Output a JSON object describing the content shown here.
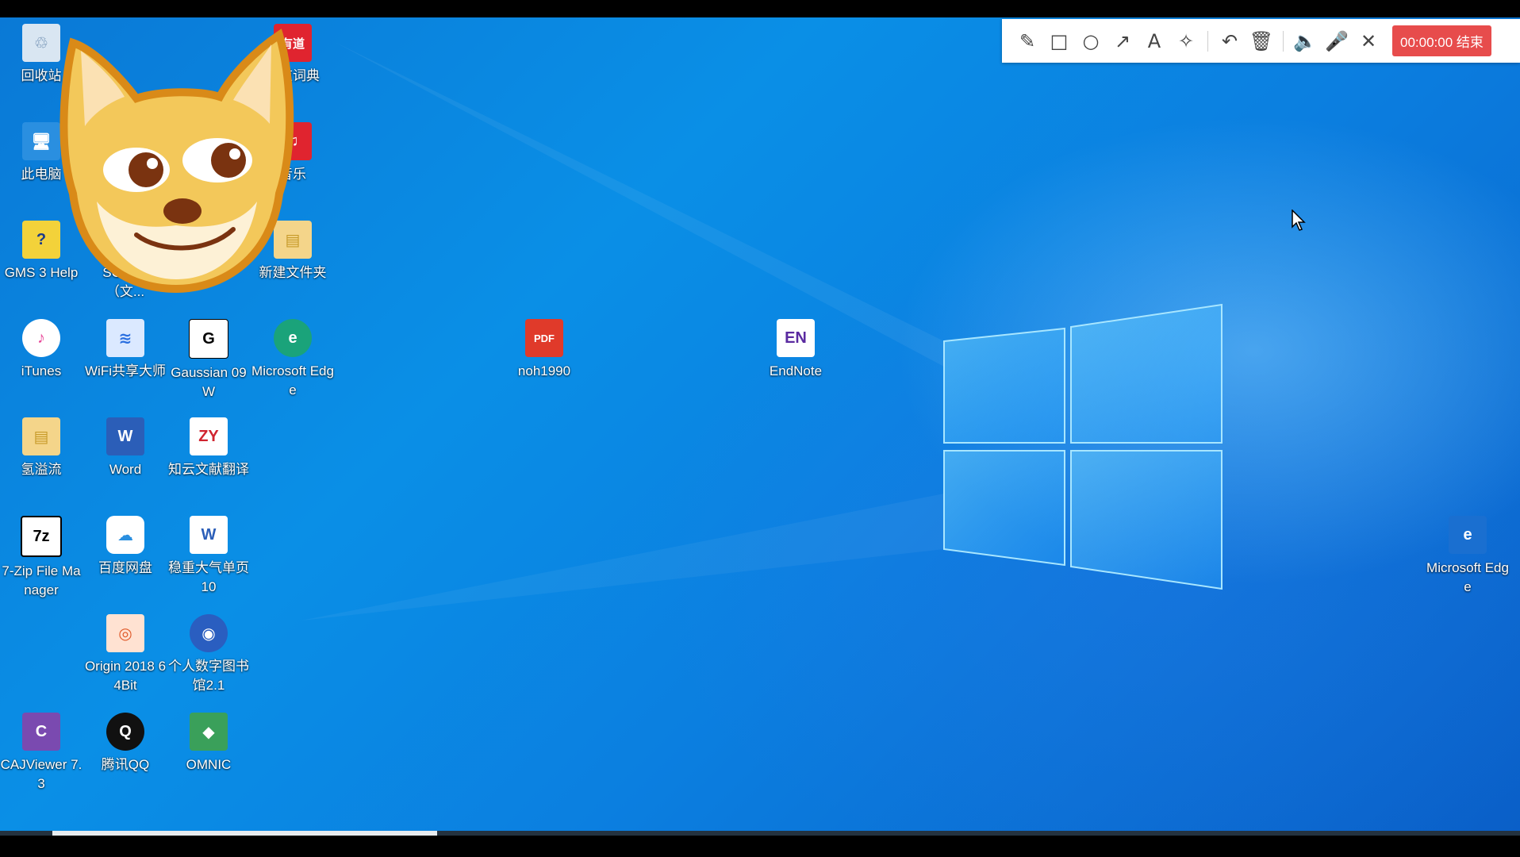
{
  "toolbar": {
    "tools": [
      {
        "icon": "pencil-icon",
        "glyph": "✎"
      },
      {
        "icon": "rectangle-icon",
        "glyph": "□"
      },
      {
        "icon": "circle-icon",
        "glyph": "○"
      },
      {
        "icon": "arrow-icon",
        "glyph": "↗"
      },
      {
        "icon": "text-icon",
        "glyph": "A"
      },
      {
        "icon": "magic-wand-icon",
        "glyph": "✧"
      }
    ],
    "undo_glyph": "↶",
    "delete_glyph": "🗑",
    "speaker_glyph": "🔈",
    "mic_glyph": "🎤",
    "close_glyph": "✕",
    "timer": "00:00:00 结束"
  },
  "desktop": {
    "icons": [
      {
        "label": "回收站",
        "icon": "recycle-bin-icon",
        "glyph": "♲",
        "color": "#d9e6f2",
        "fg": "#5a7ea6"
      },
      {
        "label": "有道词典",
        "icon": "youdao-dict-icon",
        "glyph": "有道",
        "color": "#e0242f",
        "fg": "#ffffff"
      },
      {
        "label": "此电脑",
        "icon": "this-pc-icon",
        "glyph": "🖥",
        "color": "#2a8fe0",
        "fg": "#ffffff"
      },
      {
        "label": "音乐",
        "icon": "netease-music-icon",
        "glyph": "♫",
        "color": "#e0242f",
        "fg": "#ffffff"
      },
      {
        "label": "GMS 3 Help",
        "icon": "help-file-icon",
        "glyph": "?",
        "color": "#f3d23a",
        "fg": "#1a3a8a"
      },
      {
        "label": "SC户端（文...",
        "icon": "app-shortcut-icon",
        "glyph": "S",
        "color": "#3a6fd0",
        "fg": "#ffffff"
      },
      {
        "label": "新建文件夹",
        "icon": "folder-icon",
        "glyph": "▤",
        "color": "#f4d58a",
        "fg": "#c79b2a"
      },
      {
        "label": "iTunes",
        "icon": "itunes-icon",
        "glyph": "♪",
        "color": "#ffffff",
        "fg": "#e84a9a"
      },
      {
        "label": "WiFi共享大师",
        "icon": "wifi-icon",
        "glyph": "≋",
        "color": "#dbe9ff",
        "fg": "#2a6fe0"
      },
      {
        "label": "Gaussian 09W",
        "icon": "gaussian-icon",
        "glyph": "G",
        "color": "#ffffff",
        "fg": "#000000"
      },
      {
        "label": "Microsoft Edge",
        "icon": "edge-icon",
        "glyph": "e",
        "color": "#1aa37a",
        "fg": "#ffffff"
      },
      {
        "label": "noh1990",
        "icon": "pdf-file-icon",
        "glyph": "PDF",
        "color": "#e03a2a",
        "fg": "#ffffff"
      },
      {
        "label": "EndNote",
        "icon": "endnote-icon",
        "glyph": "EN",
        "color": "#ffffff",
        "fg": "#5a2aa0"
      },
      {
        "label": "氢溢流",
        "icon": "folder-icon",
        "glyph": "▤",
        "color": "#f4d58a",
        "fg": "#c79b2a"
      },
      {
        "label": "Word",
        "icon": "word-icon",
        "glyph": "W",
        "color": "#2b5eb8",
        "fg": "#ffffff"
      },
      {
        "label": "知云文献翻译",
        "icon": "zhiyun-icon",
        "glyph": "ZY",
        "color": "#ffffff",
        "fg": "#d0242f"
      },
      {
        "label": "7-Zip File Manager",
        "icon": "7zip-icon",
        "glyph": "7z",
        "color": "#ffffff",
        "fg": "#000000"
      },
      {
        "label": "百度网盘",
        "icon": "baidu-netdisk-icon",
        "glyph": "☁",
        "color": "#ffffff",
        "fg": "#2a8fe0"
      },
      {
        "label": "稳重大气单页10",
        "icon": "word-doc-icon",
        "glyph": "W",
        "color": "#ffffff",
        "fg": "#2b5eb8"
      },
      {
        "label": "Origin 2018 64Bit",
        "icon": "origin-icon",
        "glyph": "◎",
        "color": "#ffe2d2",
        "fg": "#e05a2a"
      },
      {
        "label": "个人数字图书馆2.1",
        "icon": "digital-library-icon",
        "glyph": "◉",
        "color": "#2a5ec0",
        "fg": "#ffffff"
      },
      {
        "label": "CAJViewer 7.3",
        "icon": "cajviewer-icon",
        "glyph": "C",
        "color": "#7a4ab0",
        "fg": "#ffffff"
      },
      {
        "label": "腾讯QQ",
        "icon": "qq-icon",
        "glyph": "Q",
        "color": "#111111",
        "fg": "#ffffff"
      },
      {
        "label": "OMNIC",
        "icon": "omnic-icon",
        "glyph": "◆",
        "color": "#3aa05a",
        "fg": "#ffffff"
      },
      {
        "label": "Microsoft Edge",
        "icon": "edge-legacy-icon",
        "glyph": "e",
        "color": "#1a6fd0",
        "fg": "#ffffff"
      }
    ]
  },
  "colors": {
    "desktop_blue": "#0a8fe6",
    "timer_red": "#e74c4c"
  }
}
